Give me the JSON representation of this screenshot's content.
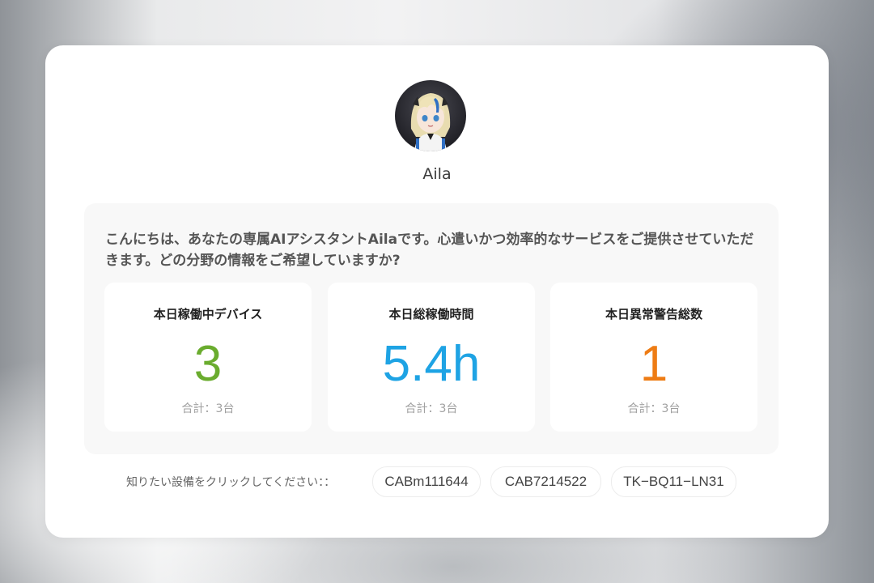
{
  "assistant": {
    "name": "Aila",
    "greeting": "こんにちは、あなたの専属AIアシスタントAilaです。心遣いかつ効率的なサービスをご提供させていただきます。どの分野の情報をご希望していますか?"
  },
  "stats": [
    {
      "label": "本日稼働中デバイス",
      "value": "3",
      "sub": "合計：3台",
      "color": "#6aac2e"
    },
    {
      "label": "本日総稼働時間",
      "value": "5.4h",
      "sub": "合計：3台",
      "color": "#1ea3e4"
    },
    {
      "label": "本日異常警告総数",
      "value": "1",
      "sub": "合計：3台",
      "color": "#ee7c14"
    }
  ],
  "devices": {
    "prompt": "知りたい設備をクリックしてください：：",
    "items": [
      "CABm111644",
      "CAB7214522",
      "TK−BQ11−LN31"
    ]
  },
  "icons": {
    "avatar": "anime-assistant-avatar"
  }
}
